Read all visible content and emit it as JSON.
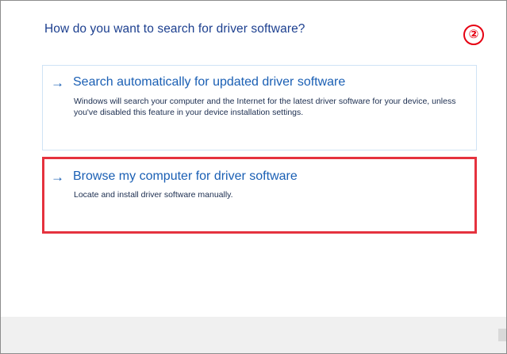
{
  "heading": "How do you want to search for driver software?",
  "step_marker": "②",
  "options": [
    {
      "title": "Search automatically for updated driver software",
      "description": "Windows will search your computer and the Internet for the latest driver software for your device, unless you've disabled this feature in your device installation settings.",
      "icon": "arrow-right-icon",
      "highlighted": false
    },
    {
      "title": "Browse my computer for driver software",
      "description": "Locate and install driver software manually.",
      "icon": "arrow-right-icon",
      "highlighted": true
    }
  ],
  "colors": {
    "heading": "#1c3f8f",
    "option_title": "#1a5fb4",
    "highlight_border": "#e5323e",
    "step_marker": "#e60012",
    "footer": "#f0f0f0"
  }
}
